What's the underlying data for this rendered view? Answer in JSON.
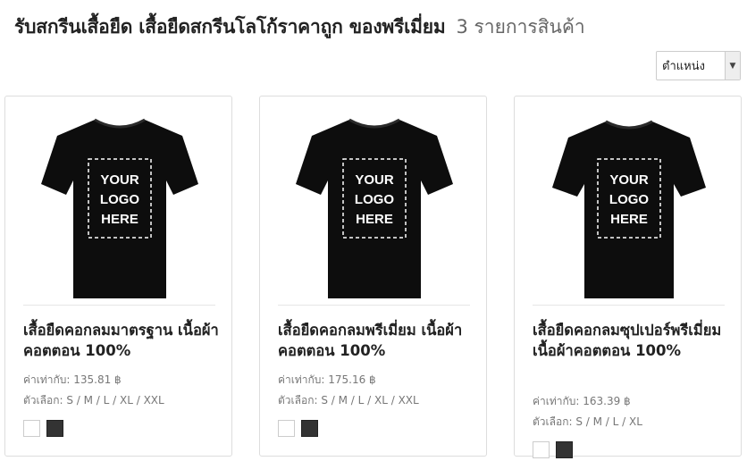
{
  "header": {
    "title": "รับสกรีนเสื้อยืด เสื้อยืดสกรีนโลโก้ราคาถูก ของพรีเมี่ยม",
    "count": "3 รายการสินค้า"
  },
  "sort": {
    "selected": "ตำแหน่ง"
  },
  "products": [
    {
      "name": "เสื้อยืดคอกลมมาตรฐาน เนื้อผ้าคอตตอน 100%",
      "price": "ค่าเท่ากับ: 135.81 ฿",
      "options": "ตัวเลือก: S / M / L / XL / XXL",
      "image_text": [
        "YOUR",
        "LOGO",
        "HERE"
      ],
      "swatches": [
        "#ffffff",
        "#333333"
      ]
    },
    {
      "name": "เสื้อยืดคอกลมพรีเมี่ยม เนื้อผ้าคอตตอน 100%",
      "price": "ค่าเท่ากับ: 175.16 ฿",
      "options": "ตัวเลือก: S / M / L / XL / XXL",
      "image_text": [
        "YOUR",
        "LOGO",
        "HERE"
      ],
      "swatches": [
        "#ffffff",
        "#333333"
      ]
    },
    {
      "name": "เสื้อยืดคอกลมซุปเปอร์พรีเมี่ยม เนื้อผ้าคอตตอน 100%",
      "price": "ค่าเท่ากับ: 163.39 ฿",
      "options": "ตัวเลือก: S / M / L / XL",
      "image_text": [
        "YOUR",
        "LOGO",
        "HERE"
      ],
      "swatches": [
        "#ffffff",
        "#333333"
      ]
    }
  ]
}
